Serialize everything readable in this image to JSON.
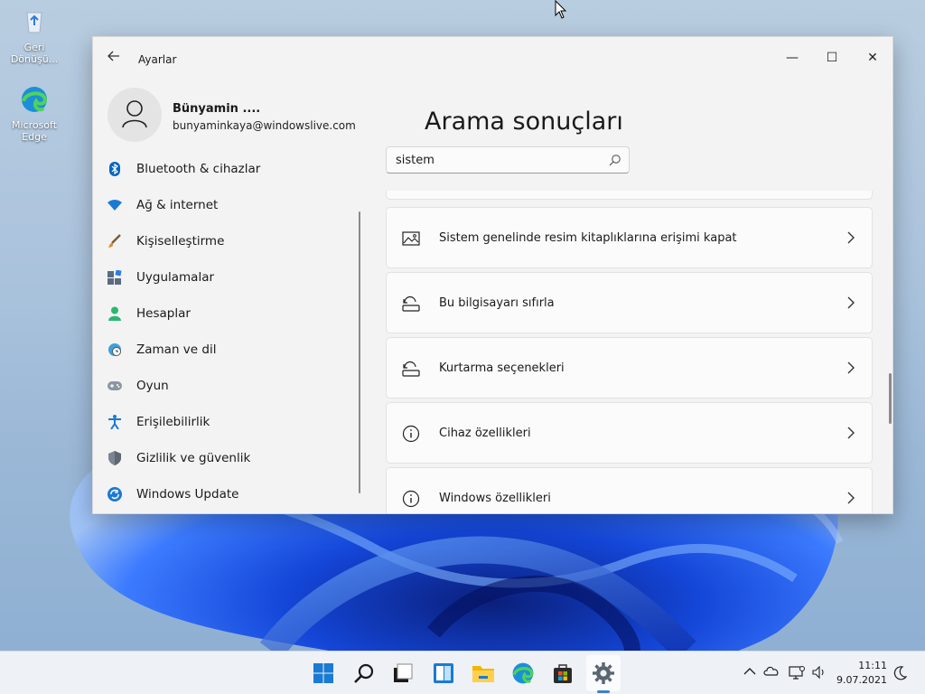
{
  "desktop": {
    "icons": [
      {
        "label_line1": "Geri",
        "label_line2": "Dönüşü...",
        "icon": "recycle-bin-icon"
      },
      {
        "label_line1": "Microsoft",
        "label_line2": "Edge",
        "icon": "edge-icon"
      }
    ]
  },
  "window": {
    "app_title": "Ayarlar",
    "controls": {
      "minimize": "—",
      "maximize": "☐",
      "close": "✕"
    }
  },
  "profile": {
    "name": "Bünyamin ....",
    "email": "bunyaminkaya@windowslive.com"
  },
  "nav": {
    "items": [
      {
        "label": "Bluetooth & cihazlar",
        "icon": "bluetooth-icon"
      },
      {
        "label": "Ağ & internet",
        "icon": "wifi-icon"
      },
      {
        "label": "Kişiselleştirme",
        "icon": "brush-icon"
      },
      {
        "label": "Uygulamalar",
        "icon": "apps-icon"
      },
      {
        "label": "Hesaplar",
        "icon": "person-icon"
      },
      {
        "label": "Zaman ve dil",
        "icon": "globe-clock-icon"
      },
      {
        "label": "Oyun",
        "icon": "gamepad-icon"
      },
      {
        "label": "Erişilebilirlik",
        "icon": "accessibility-icon"
      },
      {
        "label": "Gizlilik ve güvenlik",
        "icon": "shield-icon"
      },
      {
        "label": "Windows Update",
        "icon": "update-icon"
      }
    ]
  },
  "main": {
    "title": "Arama sonuçları",
    "search": {
      "value": "sistem"
    },
    "results": [
      {
        "label": "Sistem genelinde resim kitaplıklarına erişimi kapat",
        "icon": "image-icon"
      },
      {
        "label": "Bu bilgisayarı sıfırla",
        "icon": "reset-pc-icon"
      },
      {
        "label": "Kurtarma seçenekleri",
        "icon": "recovery-icon"
      },
      {
        "label": "Cihaz özellikleri",
        "icon": "info-icon"
      },
      {
        "label": "Windows özellikleri",
        "icon": "info-icon"
      }
    ]
  },
  "taskbar": {
    "apps": [
      "start-icon",
      "search-icon",
      "task-view-icon",
      "widgets-icon",
      "file-explorer-icon",
      "edge-icon",
      "store-icon",
      "settings-icon"
    ],
    "active_app": "settings-icon",
    "tray": {
      "chevron": "^",
      "time": "11:11",
      "date": "9.07.2021"
    }
  },
  "colors": {
    "accent": "#0067c0",
    "window_bg": "#f3f3f3",
    "taskbar_bg": "#eef1f6"
  }
}
